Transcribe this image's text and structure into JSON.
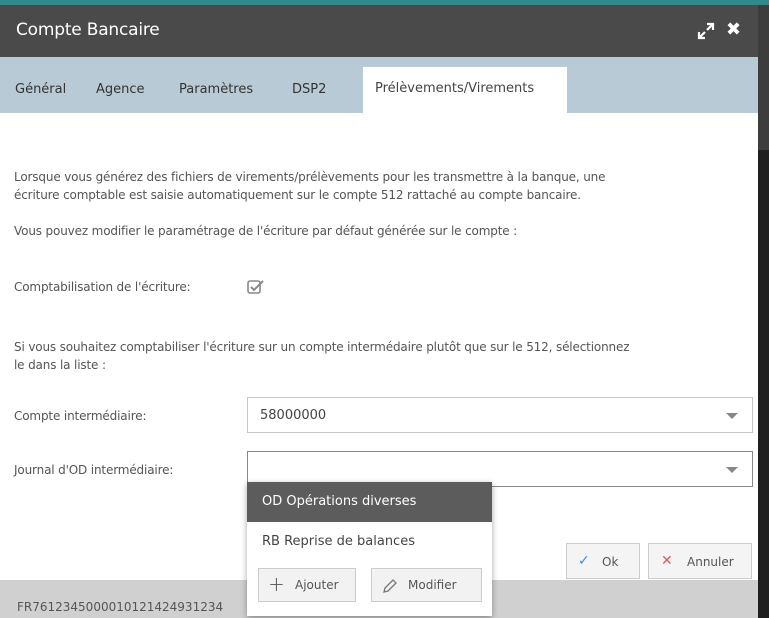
{
  "dialog": {
    "title": "Compte Bancaire",
    "expand_icon": "expand-icon",
    "close_icon": "close-icon"
  },
  "tabs": [
    {
      "label": "Général",
      "active": false
    },
    {
      "label": "Agence",
      "active": false
    },
    {
      "label": "Paramètres",
      "active": false
    },
    {
      "label": "DSP2",
      "active": false
    },
    {
      "label": "Prélèvements/Virements",
      "active": true
    }
  ],
  "content": {
    "intro_line1": "Lorsque vous générez des fichiers de virements/prélèvements pour les transmettre à la banque, une",
    "intro_line2": "écriture comptable est saisie automatiquement sur le compte 512 rattaché au compte bancaire.",
    "modify_text": "Vous pouvez modifier le paramétrage de l'écriture par défaut générée sur le compte :",
    "comptabilisation_label": "Comptabilisation de l'écriture:",
    "comptabilisation_checked": true,
    "intermediate_line1": "Si vous souhaitez comptabiliser l'écriture sur un compte intermédaire plutôt que sur le 512, sélectionnez",
    "intermediate_line2": "le dans la liste :",
    "compte_label": "Compte intermédiaire:",
    "compte_value": "58000000",
    "journal_label": "Journal d'OD intermédiaire:",
    "journal_value": ""
  },
  "buttons": {
    "ok": "Ok",
    "annuler": "Annuler"
  },
  "footer": {
    "iban": "FR7612345000010121424931234"
  },
  "dropdown": {
    "options": [
      "OD Opérations diverses",
      "RB Reprise de balances"
    ],
    "selected_index": 0,
    "add_label": "Ajouter",
    "edit_label": "Modifier"
  },
  "colors": {
    "titlebar": "#4a4a4a",
    "tabbar": "#b8cad6",
    "accent_ok": "#3a8fd9",
    "accent_cancel": "#e05a5a"
  }
}
